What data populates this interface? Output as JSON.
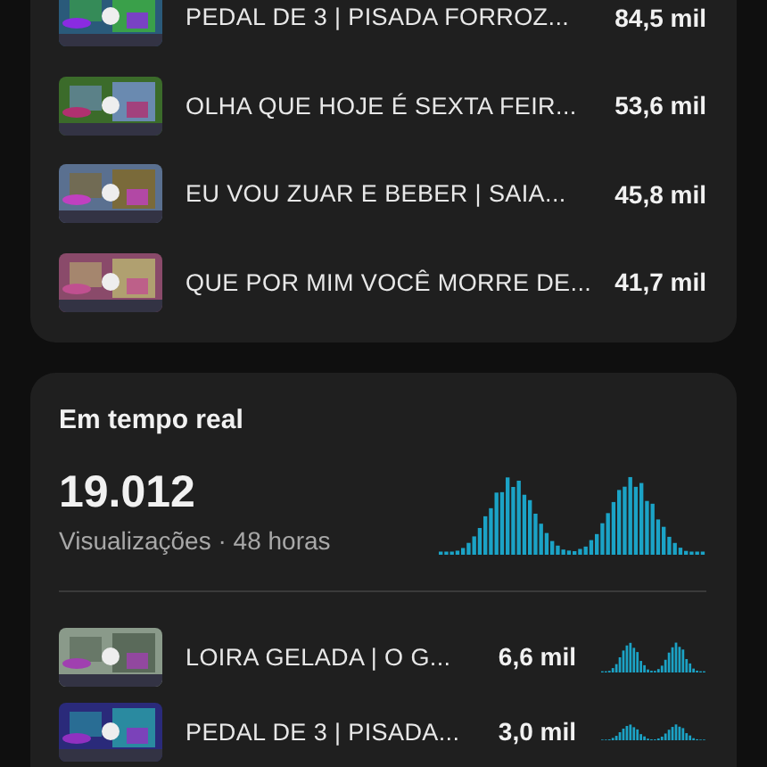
{
  "top_videos": [
    {
      "title": "PEDAL DE 3 | PISADA FORROZ...",
      "views": "84,5 mil"
    },
    {
      "title": "OLHA QUE HOJE É SEXTA FEIR...",
      "views": "53,6 mil"
    },
    {
      "title": "EU VOU ZUAR E BEBER | SAIA...",
      "views": "45,8 mil"
    },
    {
      "title": "QUE POR MIM VOCÊ MORRE DE...",
      "views": "41,7 mil"
    }
  ],
  "realtime": {
    "title": "Em tempo real",
    "total": "19.012",
    "caption": "Visualizações · 48 horas",
    "videos": [
      {
        "title": "LOIRA GELADA | O G...",
        "views": "6,6 mil"
      },
      {
        "title": "PEDAL DE 3 | PISADA...",
        "views": "3,0 mil"
      }
    ]
  }
}
